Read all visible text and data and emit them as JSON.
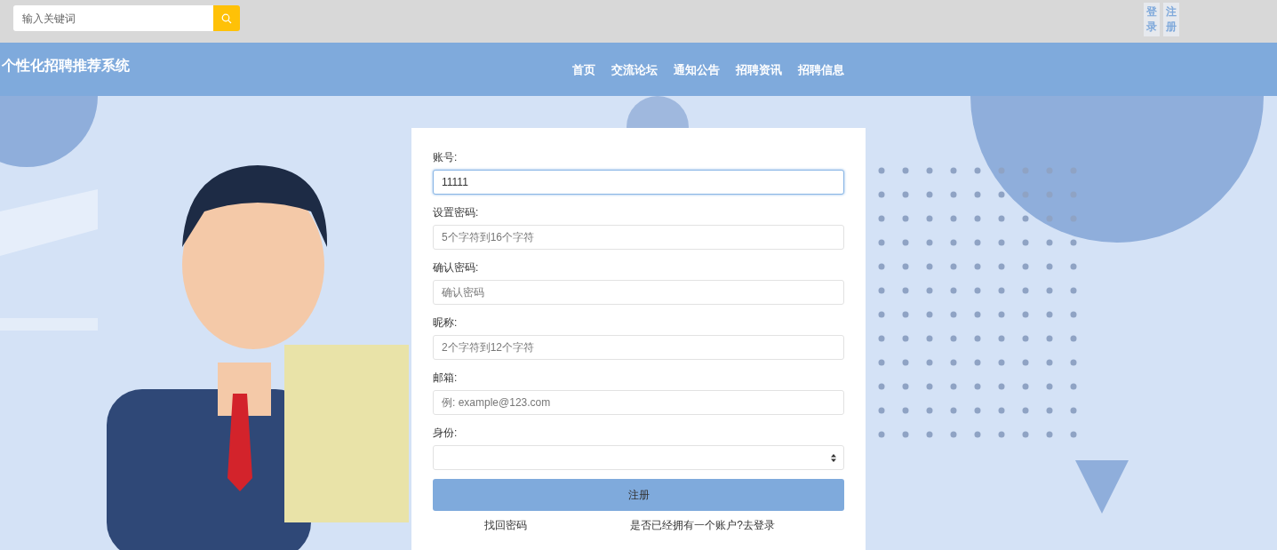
{
  "top_bar": {
    "search": {
      "placeholder": "输入关键词"
    },
    "auth_links": [
      {
        "label": "登录"
      },
      {
        "label": "注册"
      }
    ]
  },
  "header": {
    "title": "个性化招聘推荐系统",
    "nav": [
      {
        "label": "首页"
      },
      {
        "label": "交流论坛"
      },
      {
        "label": "通知公告"
      },
      {
        "label": "招聘资讯"
      },
      {
        "label": "招聘信息"
      }
    ]
  },
  "form": {
    "fields": [
      {
        "kind": "text",
        "label": "账号:",
        "value": "11111",
        "focused": true
      },
      {
        "kind": "text",
        "label": "设置密码:",
        "placeholder": "5个字符到16个字符",
        "focused": false
      },
      {
        "kind": "text",
        "label": "确认密码:",
        "placeholder": "确认密码",
        "focused": false
      },
      {
        "kind": "text",
        "label": "昵称:",
        "placeholder": "2个字符到12个字符",
        "focused": false
      },
      {
        "kind": "text",
        "label": "邮箱:",
        "placeholder": "例: example@123.com",
        "focused": false
      },
      {
        "kind": "select",
        "label": "身份:",
        "focused": false
      }
    ],
    "submit": "注册",
    "links": [
      {
        "label": "找回密码"
      },
      {
        "label": "是否已经拥有一个账户?去登录"
      }
    ]
  }
}
